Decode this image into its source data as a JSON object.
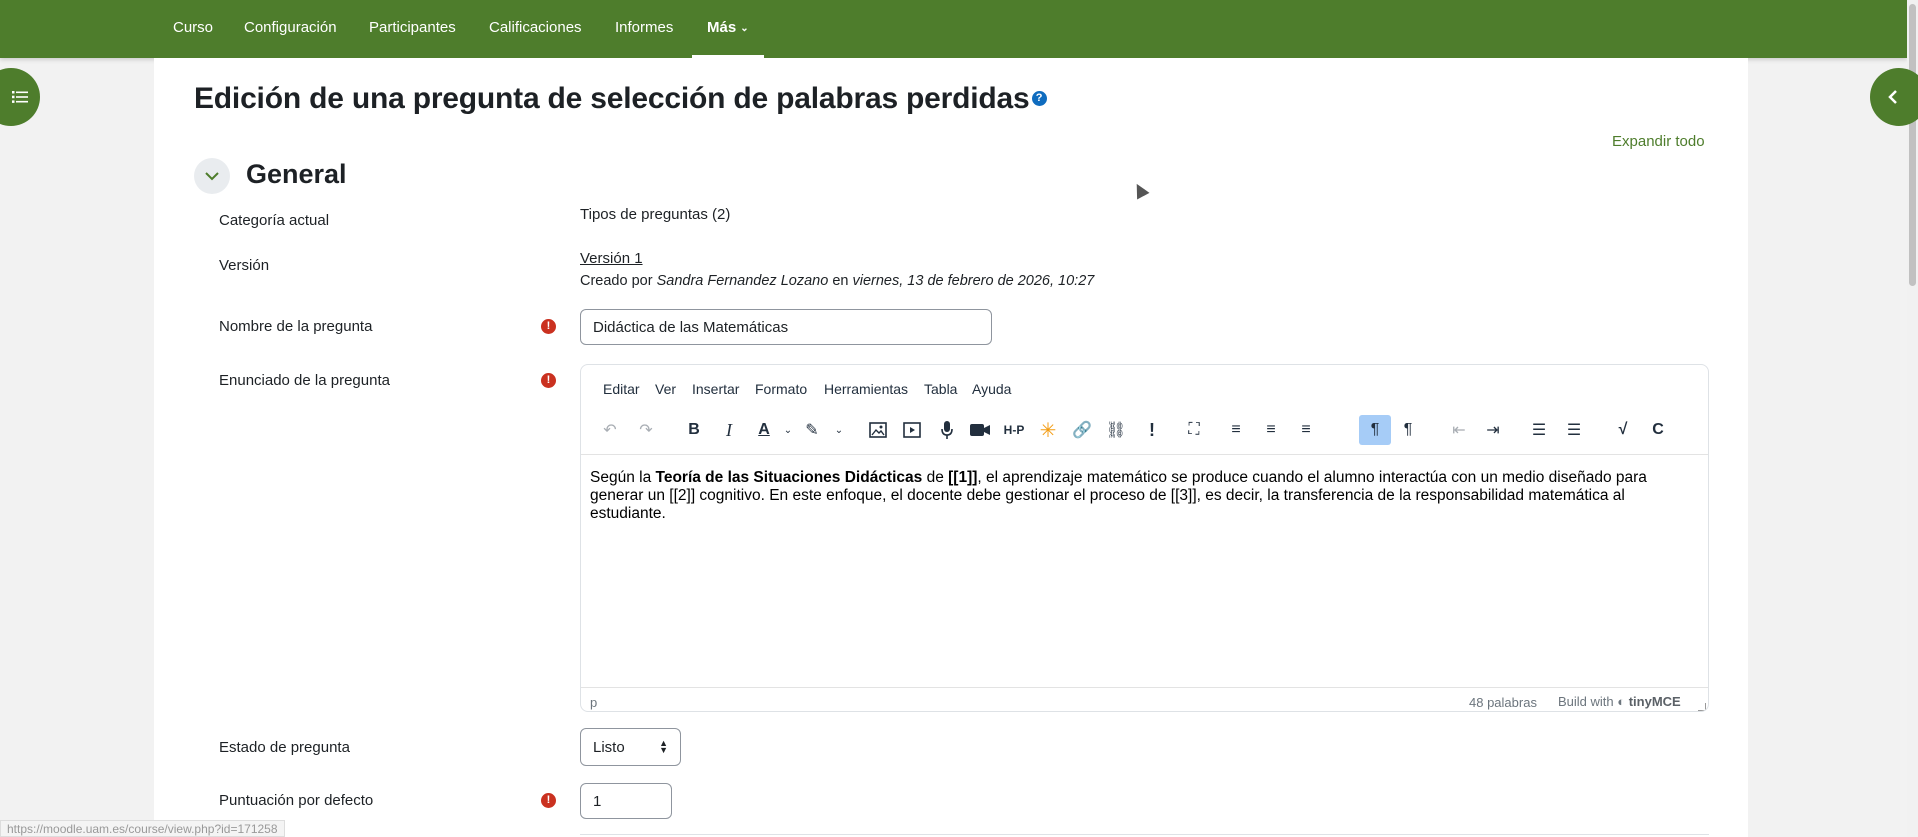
{
  "nav": {
    "items": [
      "Curso",
      "Configuración",
      "Participantes",
      "Calificaciones",
      "Informes"
    ],
    "more_label": "Más"
  },
  "page": {
    "title": "Edición de una pregunta de selección de palabras perdidas",
    "help_glyph": "?",
    "expand_all": "Expandir todo"
  },
  "section": {
    "title": "General"
  },
  "fields": {
    "category_label": "Categoría actual",
    "category_value": "Tipos de preguntas (2)",
    "version_label": "Versión",
    "version_value": "Versión 1",
    "created_prefix": "Creado por",
    "created_author": "Sandra Fernandez Lozano",
    "created_mid": "en",
    "created_date": "viernes, 13 de febrero de 2026, 10:27",
    "name_label": "Nombre de la pregunta",
    "name_value": "Didáctica de las Matemáticas",
    "statement_label": "Enunciado de la pregunta",
    "status_label": "Estado de pregunta",
    "status_value": "Listo",
    "default_mark_label": "Puntuación por defecto",
    "default_mark_value": "1",
    "required_glyph": "!"
  },
  "editor": {
    "menu": [
      "Editar",
      "Ver",
      "Insertar",
      "Formato",
      "Herramientas",
      "Tabla",
      "Ayuda"
    ],
    "content": {
      "p1": "Según la ",
      "b1": "Teoría de las Situaciones Didácticas",
      "p2": " de ",
      "b2": "[[1]]",
      "p3": ", el aprendizaje matemático se produce cuando el alumno interactúa con un medio diseñado para generar un [[2]] cognitivo. En este enfoque, el docente debe gestionar el proceso de [[3]], es decir, la transferencia de la responsabilidad matemática al estudiante."
    },
    "path": "p",
    "word_count": "48 palabras",
    "brand_prefix": "Build with",
    "brand_name": "tinyMCE"
  },
  "status_url": "https://moodle.uam.es/course/view.php?id=171258"
}
